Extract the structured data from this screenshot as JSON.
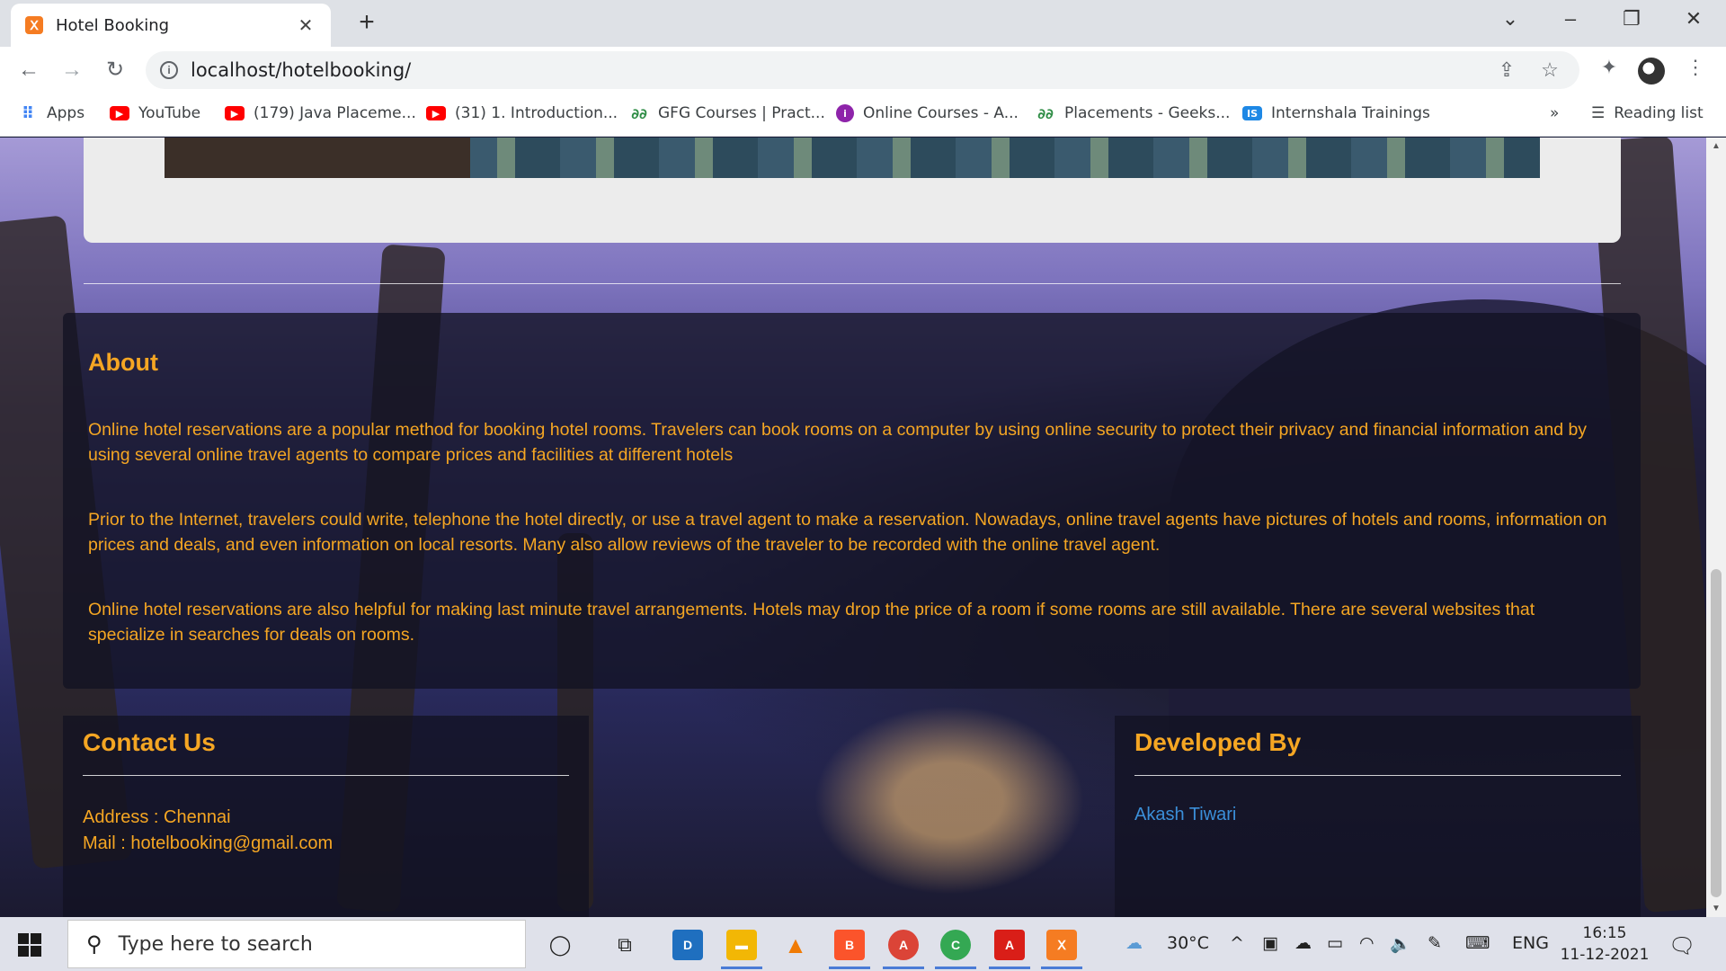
{
  "browser": {
    "tab_title": "Hotel Booking",
    "tab_close": "✕",
    "new_tab": "+",
    "url": "localhost/hotelbooking/",
    "reading_list": "Reading list",
    "overflow": "»"
  },
  "bookmarks": [
    {
      "label": "Apps",
      "icon": "apps-grid-icon"
    },
    {
      "label": "YouTube",
      "icon": "youtube-icon"
    },
    {
      "label": "(179) Java Placeme...",
      "icon": "youtube-icon"
    },
    {
      "label": "(31) 1. Introduction...",
      "icon": "youtube-icon"
    },
    {
      "label": "GFG Courses | Pract...",
      "icon": "gfg-icon"
    },
    {
      "label": "Online Courses - A...",
      "icon": "online-courses-icon"
    },
    {
      "label": "Placements - Geeks...",
      "icon": "gfg-icon"
    },
    {
      "label": "Internshala Trainings",
      "icon": "internshala-icon"
    }
  ],
  "page": {
    "about": {
      "title": "About",
      "paragraphs": [
        "Online hotel reservations are a popular method for booking hotel rooms. Travelers can book rooms on a computer by using online security to protect their privacy and financial information and by using several online travel agents to compare prices and facilities at different hotels",
        "Prior to the Internet, travelers could write, telephone the hotel directly, or use a travel agent to make a reservation. Nowadays, online travel agents have pictures of hotels and rooms, information on prices and deals, and even information on local resorts. Many also allow reviews of the traveler to be recorded with the online travel agent.",
        "Online hotel reservations are also helpful for making last minute travel arrangements. Hotels may drop the price of a room if some rooms are still available. There are several websites that specialize in searches for deals on rooms."
      ]
    },
    "contact": {
      "title": "Contact Us",
      "address": "Address : Chennai",
      "mail": "Mail : hotelbooking@gmail.com"
    },
    "developer": {
      "title": "Developed By",
      "name": "Akash Tiwari"
    }
  },
  "taskbar": {
    "search_placeholder": "Type here to search",
    "weather": "30°C",
    "language": "ENG",
    "time": "16:15",
    "date": "11-12-2021"
  },
  "colors": {
    "accent_text": "#f5a623",
    "link": "#3b8fd9",
    "panel": "rgba(18,18,34,0.78)"
  }
}
